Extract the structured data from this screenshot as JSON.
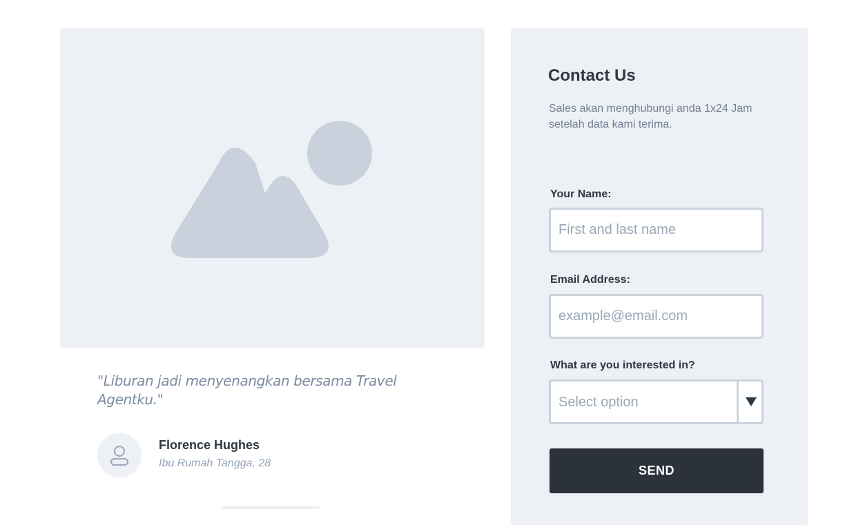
{
  "testimonial": {
    "image_icon": "image-placeholder-icon",
    "quote": "\"Liburan jadi menyenangkan bersama Travel Agentku.\"",
    "author_icon": "user-icon",
    "author_name": "Florence Hughes",
    "author_role": "Ibu Rumah Tangga, 28"
  },
  "contact": {
    "title": "Contact Us",
    "description": "Sales akan menghubungi anda 1x24 Jam setelah data kami terima.",
    "name_label": "Your Name:",
    "name_placeholder": "First and last name",
    "email_label": "Email Address:",
    "email_placeholder": "example@email.com",
    "interest_label": "What are you interested in?",
    "interest_selected": "Select option",
    "interest_icon": "triangle-down-icon",
    "send_label": "SEND"
  },
  "colors": {
    "panel": "#edf0f4",
    "placeholder_art": "#c9d2dc",
    "button": "#2c323c",
    "text_dark": "#2f3743"
  }
}
